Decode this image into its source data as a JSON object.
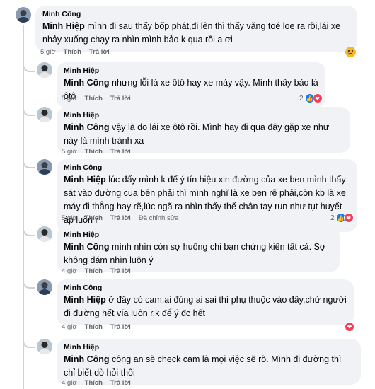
{
  "comments": [
    {
      "author": "Minh Công",
      "mention": "Minh Hiệp",
      "text": " mình đi sau thấy bốp phát,đi lên thì thấy văng toé loe ra rồi,lái xe nhảy xuống chạy ra nhìn mình bảo k qua rồi a ơi",
      "time": "5 giờ",
      "like": "Thích",
      "reply": "Trả lời",
      "reaction": "sad-face-icon"
    },
    {
      "author": "Minh Hiệp",
      "mention": "Minh Công",
      "text": " nhưng lỗi là xe ôtô hay xe máy vậy. Mình thấy bảo là ôtô",
      "time": "5 giờ",
      "like": "Thích",
      "reply": "Trả lời",
      "reaction_count": "2"
    },
    {
      "author": "Minh Hiệp",
      "mention": "Minh Công",
      "text": " vậy là do lái xe ôtô rồi. Mình hay đi qua đây gặp xe như này là mình tránh xa",
      "time": "5 giờ",
      "like": "Thích",
      "reply": "Trả lời"
    },
    {
      "author": "Minh Công",
      "mention": "Minh Hiệp",
      "text": " lúc đấy mình k để ý tín hiệu xin đường của xe ben mình thấy sát vào đường cua bên phải thì mình nghĩ là xe ben rẽ phải,còn kb là xe máy đi thẳng hay rẽ,lúc ngã ra nhìn thấy thế chân tay run như tụt huyết áp luôn r",
      "time": "5 giờ",
      "like": "Thích",
      "reply": "Trả lời",
      "edited": "Đã chỉnh sửa",
      "reaction_count": "2"
    },
    {
      "author": "Minh Hiệp",
      "mention": "Minh Công",
      "text": " mình nhìn còn sợ huống chi bạn chứng kiến tất cả. Sợ không dám nhìn luôn ý",
      "time": "4 giờ",
      "like": "Thích",
      "reply": "Trả lời"
    },
    {
      "author": "Minh Công",
      "mention": "Minh Hiệp",
      "text": " ở đấy có cam,ai đúng ai sai thì phụ thuộc vào đấy,chứ người đi đường hết vía luôn r,k để ý đc hết",
      "time": "4 giờ",
      "like": "Thích",
      "reply": "Trả lời",
      "reaction": "love-icon"
    },
    {
      "author": "Minh Hiệp",
      "mention": "Minh Công",
      "text": " công an sẽ check cam là mọi việc sẽ rõ. Mình đi đường thì chỉ biết dò hỏi thôi",
      "time": "4 giờ",
      "like": "Thích",
      "reply": "Trả lời"
    }
  ]
}
